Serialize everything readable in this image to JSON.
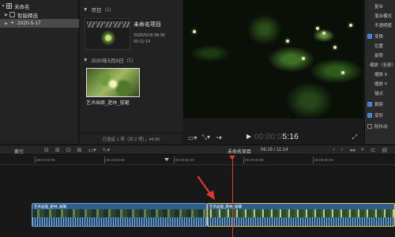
{
  "library": {
    "items": [
      {
        "label": "未命名",
        "icon": "grid-icon",
        "expanded": true
      },
      {
        "label": "智能精选",
        "icon": "folder-icon",
        "expanded": false
      },
      {
        "label": "2020-5-17",
        "icon": "star-icon",
        "expanded": false,
        "selected": true
      }
    ]
  },
  "browser": {
    "group1_label": "项目",
    "group1_count": "(1)",
    "project_title": "未命名项目",
    "project_date": "2020/5/18 08:36",
    "project_duration": "00:11:14",
    "group2_label": "2020年5月8日",
    "group2_count": "(1)",
    "clip_caption": "艺术画面_肥林_拔罐",
    "status": "已选定 1 项（共 2 项），44:00"
  },
  "viewer": {
    "timecode_dim": "00:00:0",
    "timecode": "5:16"
  },
  "inspector": {
    "items": [
      {
        "label": "复合",
        "checkbox": "none"
      },
      {
        "label": "混合模式",
        "checkbox": "none"
      },
      {
        "label": "不透明度",
        "checkbox": "none"
      },
      {
        "label": "变换",
        "checkbox": "on"
      },
      {
        "label": "位置",
        "checkbox": "none",
        "indent": true
      },
      {
        "label": "旋转",
        "checkbox": "none",
        "indent": true
      },
      {
        "label": "缩放（全部）",
        "checkbox": "none",
        "indent": true
      },
      {
        "label": "缩放 X",
        "checkbox": "none",
        "indent": true
      },
      {
        "label": "缩放 Y",
        "checkbox": "none",
        "indent": true
      },
      {
        "label": "锚点",
        "checkbox": "none",
        "indent": true
      },
      {
        "label": "裁剪",
        "checkbox": "on"
      },
      {
        "label": "变形",
        "checkbox": "on"
      },
      {
        "label": "防抖动",
        "checkbox": "off"
      }
    ]
  },
  "timeline_header": {
    "index": "索引",
    "project": "未命名项目",
    "time": "06:16 / 11:14"
  },
  "ruler": [
    "00:00:00:00",
    "00:00:02:00",
    "00:00:04:00",
    "00:00:06:00",
    "00:00:08:00"
  ],
  "clips": [
    {
      "label": "艺术画面_肥林_拔罐"
    },
    {
      "label": "艺术画面_肥林_拔罐"
    }
  ],
  "colors": {
    "accent": "#3a7bd5",
    "playhead": "#e03a2e",
    "clip": "#2f5f8e",
    "selection": "#f2c44b"
  }
}
